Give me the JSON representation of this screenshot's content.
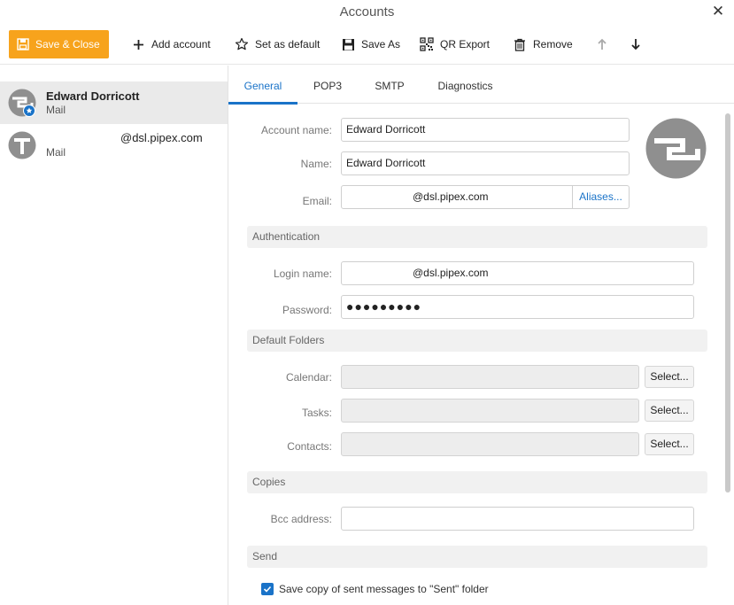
{
  "window": {
    "title": "Accounts"
  },
  "toolbar": {
    "save_close": "Save & Close",
    "add_account": "Add account",
    "set_default": "Set as default",
    "save_as": "Save As",
    "qr_export": "QR Export",
    "remove": "Remove"
  },
  "accounts": [
    {
      "name": "Edward Dorricott",
      "type": "Mail"
    },
    {
      "email_visible": "@dsl.pipex.com",
      "type": "Mail"
    }
  ],
  "tabs": [
    "General",
    "POP3",
    "SMTP",
    "Diagnostics"
  ],
  "general": {
    "account_name_label": "Account name:",
    "account_name_value": "Edward Dorricott",
    "name_label": "Name:",
    "name_value": "Edward Dorricott",
    "email_label": "Email:",
    "email_value": "@dsl.pipex.com",
    "aliases_label": "Aliases..."
  },
  "authentication": {
    "section_title": "Authentication",
    "login_label": "Login name:",
    "login_value": "@dsl.pipex.com",
    "password_label": "Password:",
    "password_value": "●●●●●●●●●"
  },
  "default_folders": {
    "section_title": "Default Folders",
    "calendar_label": "Calendar:",
    "tasks_label": "Tasks:",
    "contacts_label": "Contacts:",
    "select_label": "Select..."
  },
  "copies": {
    "section_title": "Copies",
    "bcc_label": "Bcc address:",
    "bcc_value": ""
  },
  "send": {
    "section_title": "Send",
    "save_copy_label": "Save copy of sent messages to \"Sent\" folder",
    "save_copy_checked": true
  },
  "colors": {
    "accent": "#1a73c8",
    "save_button": "#f7a31c"
  }
}
